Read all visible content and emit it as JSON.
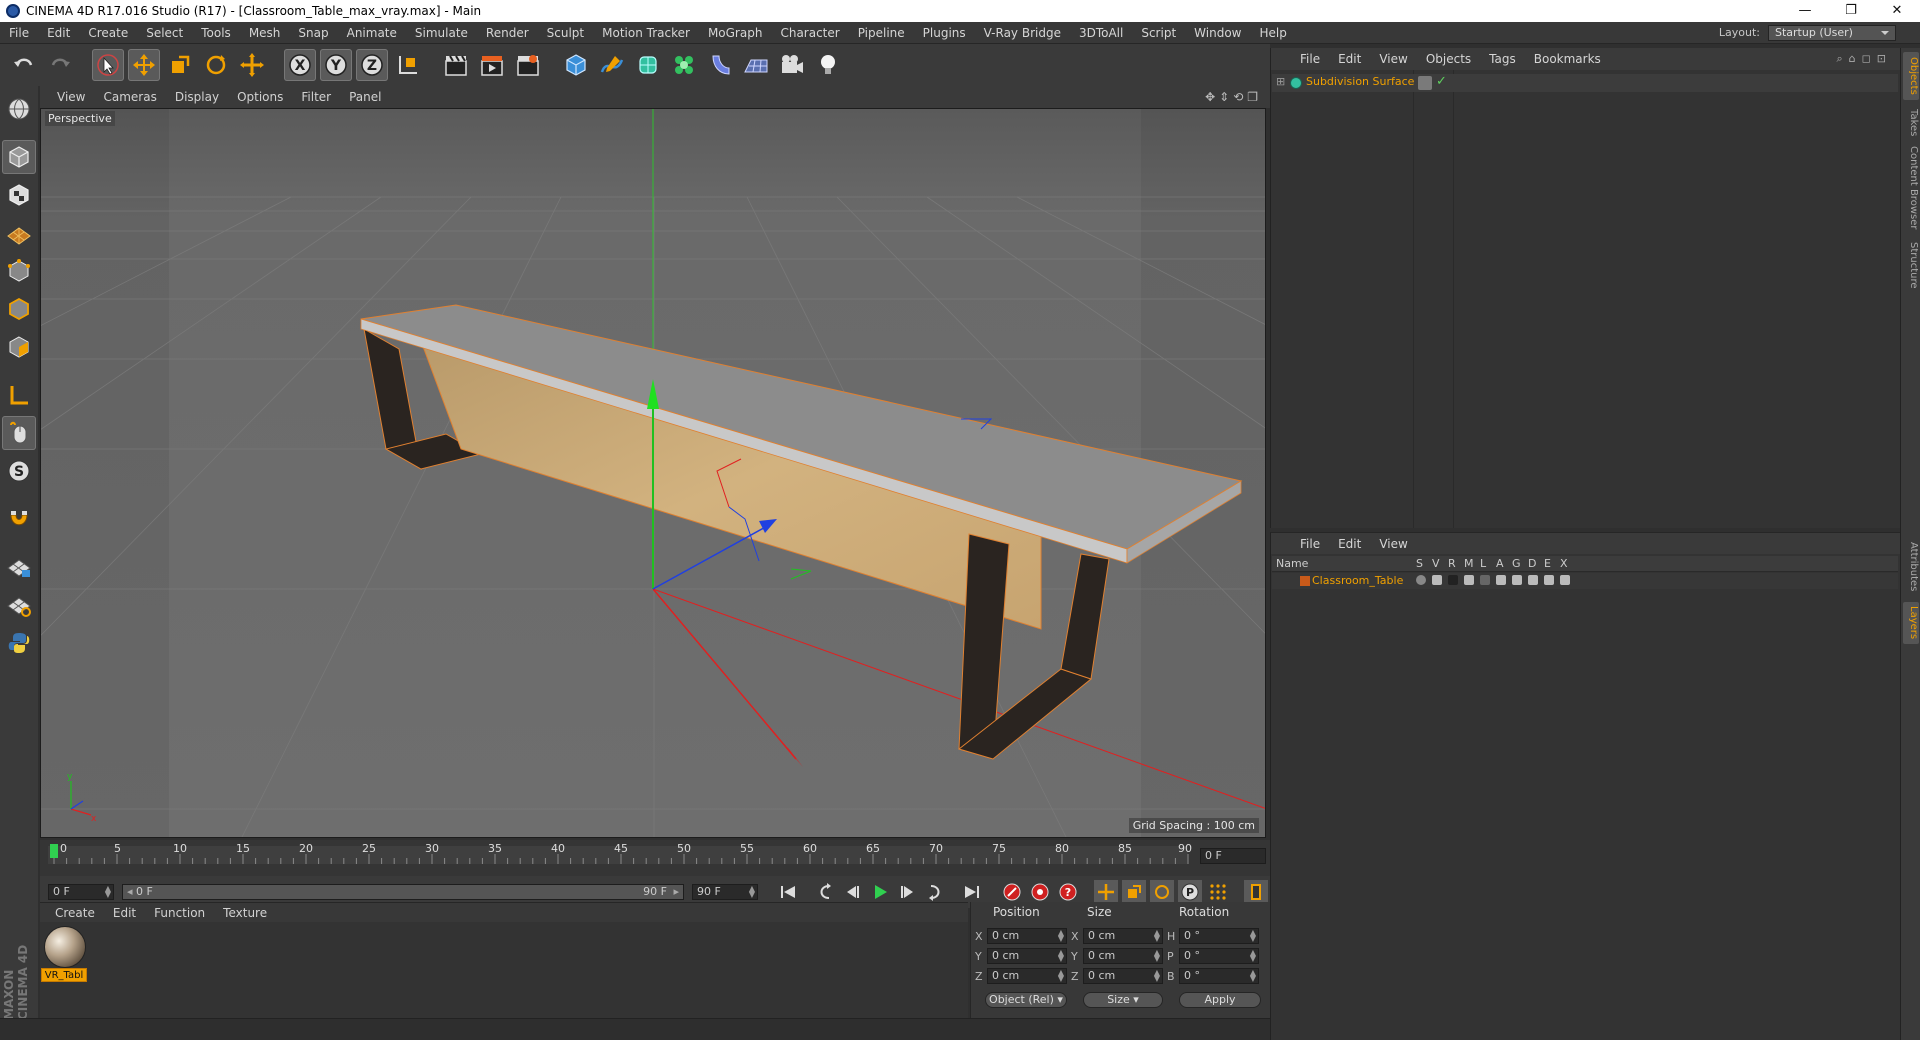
{
  "window": {
    "title": "CINEMA 4D R17.016 Studio (R17) - [Classroom_Table_max_vray.max] - Main",
    "minimize": "—",
    "restore": "❐",
    "close": "✕"
  },
  "menubar": {
    "items": [
      "File",
      "Edit",
      "Create",
      "Select",
      "Tools",
      "Mesh",
      "Snap",
      "Animate",
      "Simulate",
      "Render",
      "Sculpt",
      "Motion Tracker",
      "MoGraph",
      "Character",
      "Pipeline",
      "Plugins",
      "V-Ray Bridge",
      "3DToAll",
      "Script",
      "Window",
      "Help"
    ],
    "layout_label": "Layout:",
    "layout_value": "Startup (User)"
  },
  "viewport": {
    "menu": [
      "View",
      "Cameras",
      "Display",
      "Options",
      "Filter",
      "Panel"
    ],
    "label": "Perspective",
    "grid_spacing": "Grid Spacing : 100 cm"
  },
  "timeline": {
    "ticks": [
      "0",
      "5",
      "10",
      "15",
      "20",
      "25",
      "30",
      "35",
      "40",
      "45",
      "50",
      "55",
      "60",
      "65",
      "70",
      "75",
      "80",
      "85",
      "90"
    ],
    "current_frame": "0 F"
  },
  "transport": {
    "start": "0 F",
    "range_start": "0 F",
    "range_end": "90 F",
    "end": "90 F"
  },
  "materials": {
    "menu": [
      "Create",
      "Edit",
      "Function",
      "Texture"
    ],
    "items": [
      {
        "name": "VR_Tabl"
      }
    ]
  },
  "brand": "MAXON CINEMA 4D",
  "coordinates": {
    "headers": [
      "Position",
      "Size",
      "Rotation"
    ],
    "rows": [
      {
        "axis": "X",
        "pos": "0 cm",
        "size_axis": "X",
        "size": "0 cm",
        "rot_axis": "H",
        "rot": "0 °"
      },
      {
        "axis": "Y",
        "pos": "0 cm",
        "size_axis": "Y",
        "size": "0 cm",
        "rot_axis": "P",
        "rot": "0 °"
      },
      {
        "axis": "Z",
        "pos": "0 cm",
        "size_axis": "Z",
        "size": "0 cm",
        "rot_axis": "B",
        "rot": "0 °"
      }
    ],
    "mode": "Object (Rel)",
    "size_mode": "Size",
    "apply": "Apply"
  },
  "objects": {
    "menu": [
      "File",
      "Edit",
      "View",
      "Objects",
      "Tags",
      "Bookmarks"
    ],
    "items": [
      {
        "name": "Subdivision Surface"
      }
    ]
  },
  "layers": {
    "menu": [
      "File",
      "Edit",
      "View"
    ],
    "columns": [
      "Name",
      "S",
      "V",
      "R",
      "M",
      "L",
      "A",
      "G",
      "D",
      "E",
      "X"
    ],
    "items": [
      {
        "name": "Classroom_Table"
      }
    ]
  },
  "side_tabs": [
    "Objects",
    "Takes",
    "Content Browser",
    "Structure",
    "Attributes",
    "Layers"
  ],
  "colors": {
    "accent": "#f0a000",
    "axis_x": "#e02020",
    "axis_y": "#20c020",
    "axis_z": "#2040e0"
  }
}
